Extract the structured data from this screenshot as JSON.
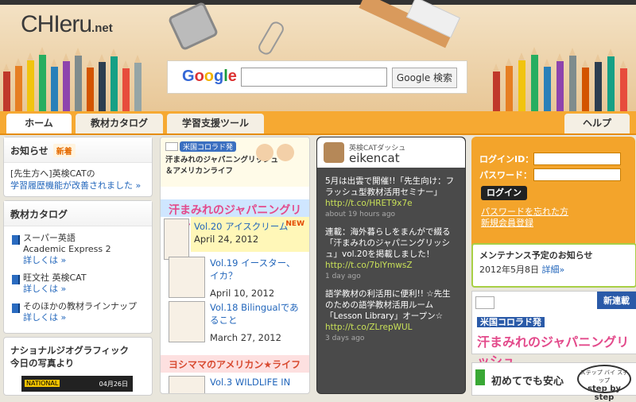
{
  "site": {
    "logo_main": "CHIeru",
    "logo_tld": ".net"
  },
  "search": {
    "google_label": "Google",
    "button_label": "Google 検索",
    "placeholder": ""
  },
  "nav": {
    "tabs": [
      "ホーム",
      "教材カタログ",
      "学習支援ツール"
    ],
    "help": "ヘルプ"
  },
  "news": {
    "title": "お知らせ",
    "badge": "新着",
    "line1": "[先生方へ]英検CATの",
    "line2": "学習履歴機能が改善されました »"
  },
  "catalog": {
    "title": "教材カタログ",
    "items": [
      {
        "name": "スーパー英語",
        "sub": "Academic Express 2",
        "more": "詳しくは »"
      },
      {
        "name": "旺文社 英検CAT",
        "sub": "",
        "more": "詳しくは »"
      },
      {
        "name": "そのほかの教材ラインナップ",
        "sub": "",
        "more": "詳しくは »"
      }
    ]
  },
  "natgeo": {
    "title_line1": "ナショナルジオグラフィック",
    "title_line2": "今日の写真より",
    "logo": "NATIONAL",
    "date": "04月26日"
  },
  "manga": {
    "banner_label": "米国コロラド発",
    "banner_title": "汗まみれのジャパニングリッシュ＆アメリカンライフ",
    "series1_title": "汗まみれのジャパニングリッシュ",
    "new_badge": "NEW",
    "episodes1": [
      {
        "title": "Vol.20 アイスクリーム",
        "date": "April 24, 2012"
      },
      {
        "title": "Vol.19 イースター、イカ？",
        "date": "April 10, 2012"
      },
      {
        "title": "Vol.18 Bilingualであること",
        "date": "March 27, 2012"
      }
    ],
    "series2_title": "ヨシママのアメリカン★ライフ",
    "episodes2": [
      {
        "title": "Vol.3 WILDLIFE IN",
        "date": ""
      }
    ]
  },
  "twitter": {
    "sub": "英検CATダッシュ",
    "name": "eikencat",
    "tweets": [
      {
        "text": "5月は出雲で開催!!「先生向け：フラッシュ型教材活用セミナー」",
        "link": "http://t.co/HRET9x7e",
        "time": "about 19 hours ago"
      },
      {
        "text": "連載：海外暮らしをまんがで綴る「汗まみれのジャパニングリッシュ」vol.20を掲載しました！",
        "link": "http://t.co/7blYmwsZ",
        "time": "1 day ago"
      },
      {
        "text": "語学教材の利活用に便利!! ☆先生のための語学教材活用ルーム「Lesson Library」オープン☆",
        "link": "http://t.co/ZLrepWUL",
        "time": "3 days ago"
      }
    ]
  },
  "login": {
    "id_label": "ログインID：",
    "password_label": "パスワード：",
    "button": "ログイン",
    "forgot": "パスワードを忘れた方",
    "register": "新規会員登録"
  },
  "maintenance": {
    "title": "メンテナンス予定のお知らせ",
    "date": "2012年5月8日",
    "more": "詳細»"
  },
  "side_banner": {
    "badge": "新連載",
    "tag": "米国コロラド発",
    "title": "汗まみれのジャパニングリッシュ"
  },
  "bottom_banner": {
    "text": "初めてでも安心",
    "sticker_top": "ステップ バイ ステップ",
    "sticker_main": "step by step"
  },
  "colors": {
    "nav_orange": "#f6a932",
    "login_orange": "#f3a42b",
    "link_blue": "#2266bb",
    "twitter_bg": "#4a4a4a"
  }
}
